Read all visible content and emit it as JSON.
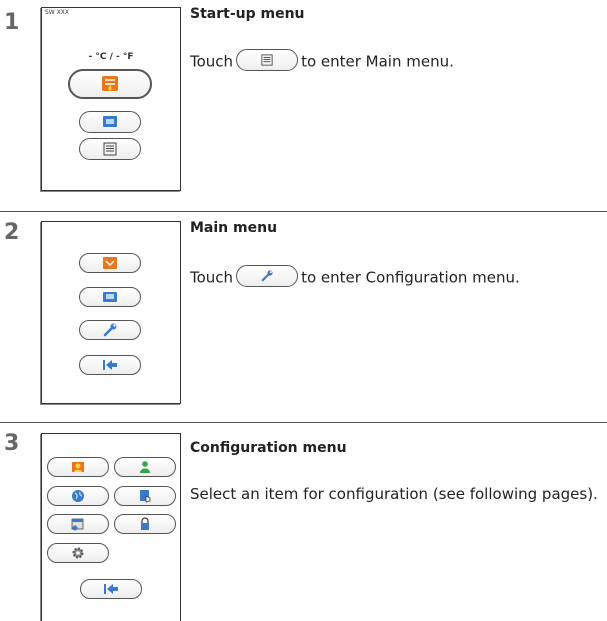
{
  "steps": [
    {
      "number": "1",
      "heading": "Start-up menu",
      "desc_before": "Touch",
      "desc_after": "to enter Main menu.",
      "screen": {
        "sw_label": "SW XXX",
        "temp": "- °C /   - °F"
      }
    },
    {
      "number": "2",
      "heading": "Main menu",
      "desc_before": "Touch",
      "desc_after": "to enter Configuration menu."
    },
    {
      "number": "3",
      "heading": "Configuration menu",
      "desc": "Select an item for configuration (see following pages)."
    }
  ],
  "colors": {
    "accent": "#e8761c",
    "blue": "#3a7bc8",
    "green": "#3aa34a",
    "divider": "#555555"
  },
  "icons": [
    "heater-icon",
    "display-icon",
    "menu-list-icon",
    "wrench-icon",
    "exit-icon",
    "user-icon",
    "person-icon",
    "globe-icon",
    "touch-screen-icon",
    "calendar-icon",
    "lock-icon",
    "gear-icon"
  ]
}
